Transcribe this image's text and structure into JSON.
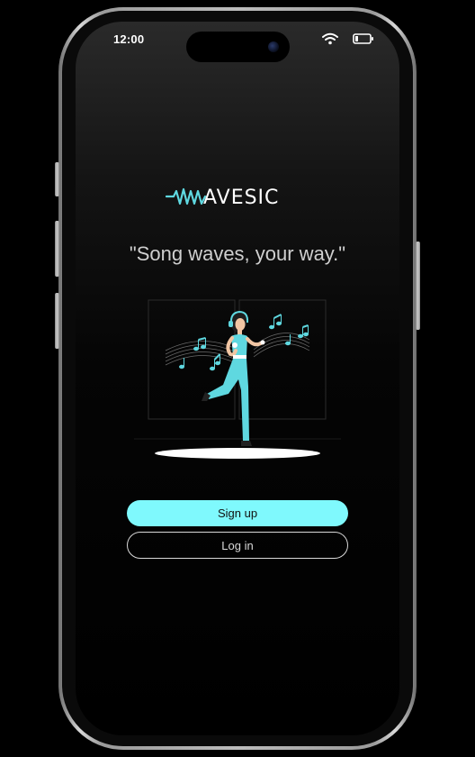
{
  "status_bar": {
    "time": "12:00",
    "wifi_icon": "wifi-icon",
    "battery_icon": "battery-icon"
  },
  "brand": {
    "logo_wave_icon": "audio-wave-icon",
    "logo_text": "AVESIC"
  },
  "tagline": "\"Song waves, your way.\"",
  "illustration": {
    "icon": "dancing-woman-with-music-notes-icon"
  },
  "actions": {
    "signup_label": "Sign up",
    "login_label": "Log in"
  },
  "colors": {
    "accent": "#7ff9fd",
    "illustration_teal": "#5fd8e0",
    "background": "#000000",
    "text_muted": "#cfcfcf"
  }
}
